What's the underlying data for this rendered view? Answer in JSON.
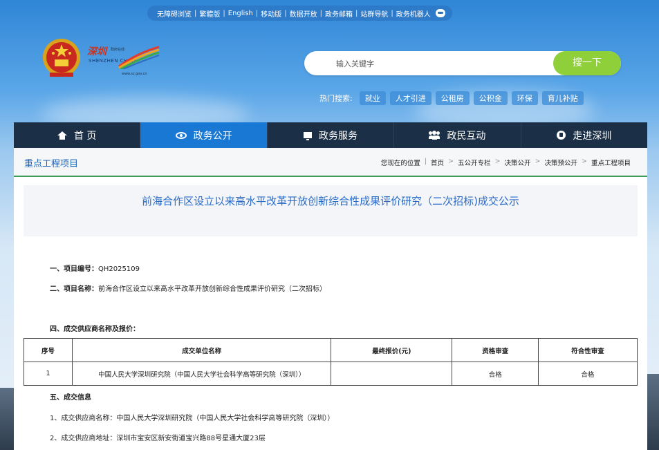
{
  "topbar": {
    "items": [
      "无障碍浏览",
      "繁體版",
      "English",
      "移动版",
      "数据开放",
      "政务邮箱",
      "站群导航",
      "政务机器人"
    ]
  },
  "logo": {
    "cn": "深圳",
    "sub": "政府在线",
    "en": "SHENZHEN CHINA",
    "url": "www.sz.gov.cn"
  },
  "search": {
    "placeholder": "输入关键字",
    "button_label": "搜一下"
  },
  "hot_search": {
    "label": "热门搜索:",
    "tags": [
      "就业",
      "人才引进",
      "公租房",
      "公积金",
      "环保",
      "育儿补贴"
    ]
  },
  "nav": {
    "items": [
      {
        "label": "首 页",
        "icon": "home-icon"
      },
      {
        "label": "政务公开",
        "icon": "eye-icon"
      },
      {
        "label": "政务服务",
        "icon": "monitor-icon"
      },
      {
        "label": "政民互动",
        "icon": "people-icon"
      },
      {
        "label": "走进深圳",
        "icon": "compass-icon"
      }
    ],
    "active_index": 1
  },
  "breadcrumb": {
    "section_title": "重点工程项目",
    "prefix": "您现在的位置",
    "items": [
      "首页",
      "五公开专栏",
      "决策公开",
      "决策预公开",
      "重点工程项目"
    ]
  },
  "article": {
    "title": "前海合作区设立以来高水平改革开放创新综合性成果评价研究（二次招标)成交公示",
    "project_no_label": "一、项目编号：",
    "project_no": "QH2025109",
    "project_name_label": "二、项目名称：",
    "project_name": "前海合作区设立以来高水平改革开放创新综合性成果评价研究（二次招标）",
    "supplier_section": "四、成交供应商名称及报价：",
    "table": {
      "headers": [
        "序号",
        "成交单位名称",
        "最终报价(元)",
        "资格审查",
        "符合性审查"
      ],
      "rows": [
        [
          "1",
          "中国人民大学深圳研究院（中国人民大学社会科学高等研究院（深圳））",
          "",
          "合格",
          "合格"
        ]
      ]
    },
    "deal_section": "五、成交信息",
    "deal_name_label": "1、成交供应商名称：",
    "deal_name": "中国人民大学深圳研究院（中国人民大学社会科学高等研究院（深圳））",
    "deal_addr_label": "2、成交供应商地址：",
    "deal_addr": "深圳市宝安区新安街道宝兴路88号星通大厦23层"
  },
  "colors": {
    "nav_bg": "#1b2f46",
    "nav_active": "#1978d4",
    "search_button": "#8ecf3a",
    "title_blue": "#2a6bc7"
  }
}
